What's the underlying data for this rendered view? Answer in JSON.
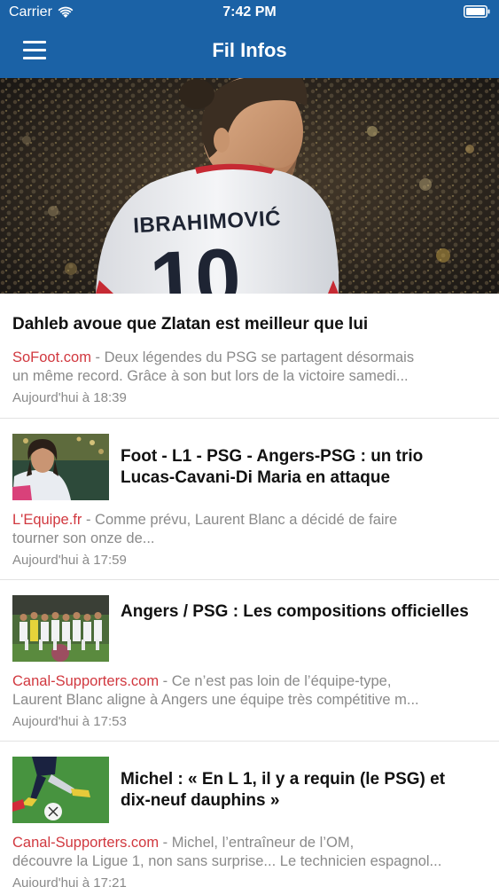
{
  "status_bar": {
    "carrier": "Carrier",
    "time": "7:42 PM"
  },
  "header": {
    "title": "Fil Infos",
    "menu_icon": "hamburger-menu-icon"
  },
  "hero": {
    "jersey_name": "IBRAHIMOVIĆ",
    "jersey_number": "10"
  },
  "articles": [
    {
      "title": "Dahleb avoue que Zlatan est meilleur que lui",
      "source": "SoFoot.com",
      "separator": " - ",
      "excerpt_line1": "Deux légendes du PSG se partagent désormais",
      "excerpt_line2": "un même record.  Grâce à son but lors de la victoire samedi...",
      "time": "Aujourd'hui à 18:39"
    },
    {
      "title_line1": "Foot - L1 - PSG - Angers-PSG : un trio",
      "title_line2": "Lucas-Cavani-Di Maria en attaque",
      "source": "L'Equipe.fr",
      "separator": " - ",
      "excerpt_line1": "Comme prévu, Laurent Blanc a décidé de faire",
      "excerpt_line2": "tourner son onze de...",
      "time": "Aujourd'hui à 17:59"
    },
    {
      "title_line1": "Angers / PSG : Les compositions officielles",
      "source": "Canal-Supporters.com",
      "separator": " - ",
      "excerpt_line1": "Ce n’est pas loin de l’équipe-type,",
      "excerpt_line2": "Laurent Blanc aligne à Angers une équipe très compétitive m...",
      "time": "Aujourd'hui à 17:53"
    },
    {
      "title_line1": "Michel : « En L 1, il y a requin (le PSG) et",
      "title_line2": "dix-neuf dauphins »",
      "source": "Canal-Supporters.com",
      "separator": " - ",
      "excerpt_line1": "Michel, l’entraîneur de l’OM,",
      "excerpt_line2": "découvre la Ligue 1, non sans surprise... Le technicien espagnol...",
      "time": "Aujourd'hui à 17:21"
    }
  ],
  "colors": {
    "header_bg": "#1b62a6",
    "source_red": "#d1383f",
    "muted_text": "#8a8a8a"
  }
}
